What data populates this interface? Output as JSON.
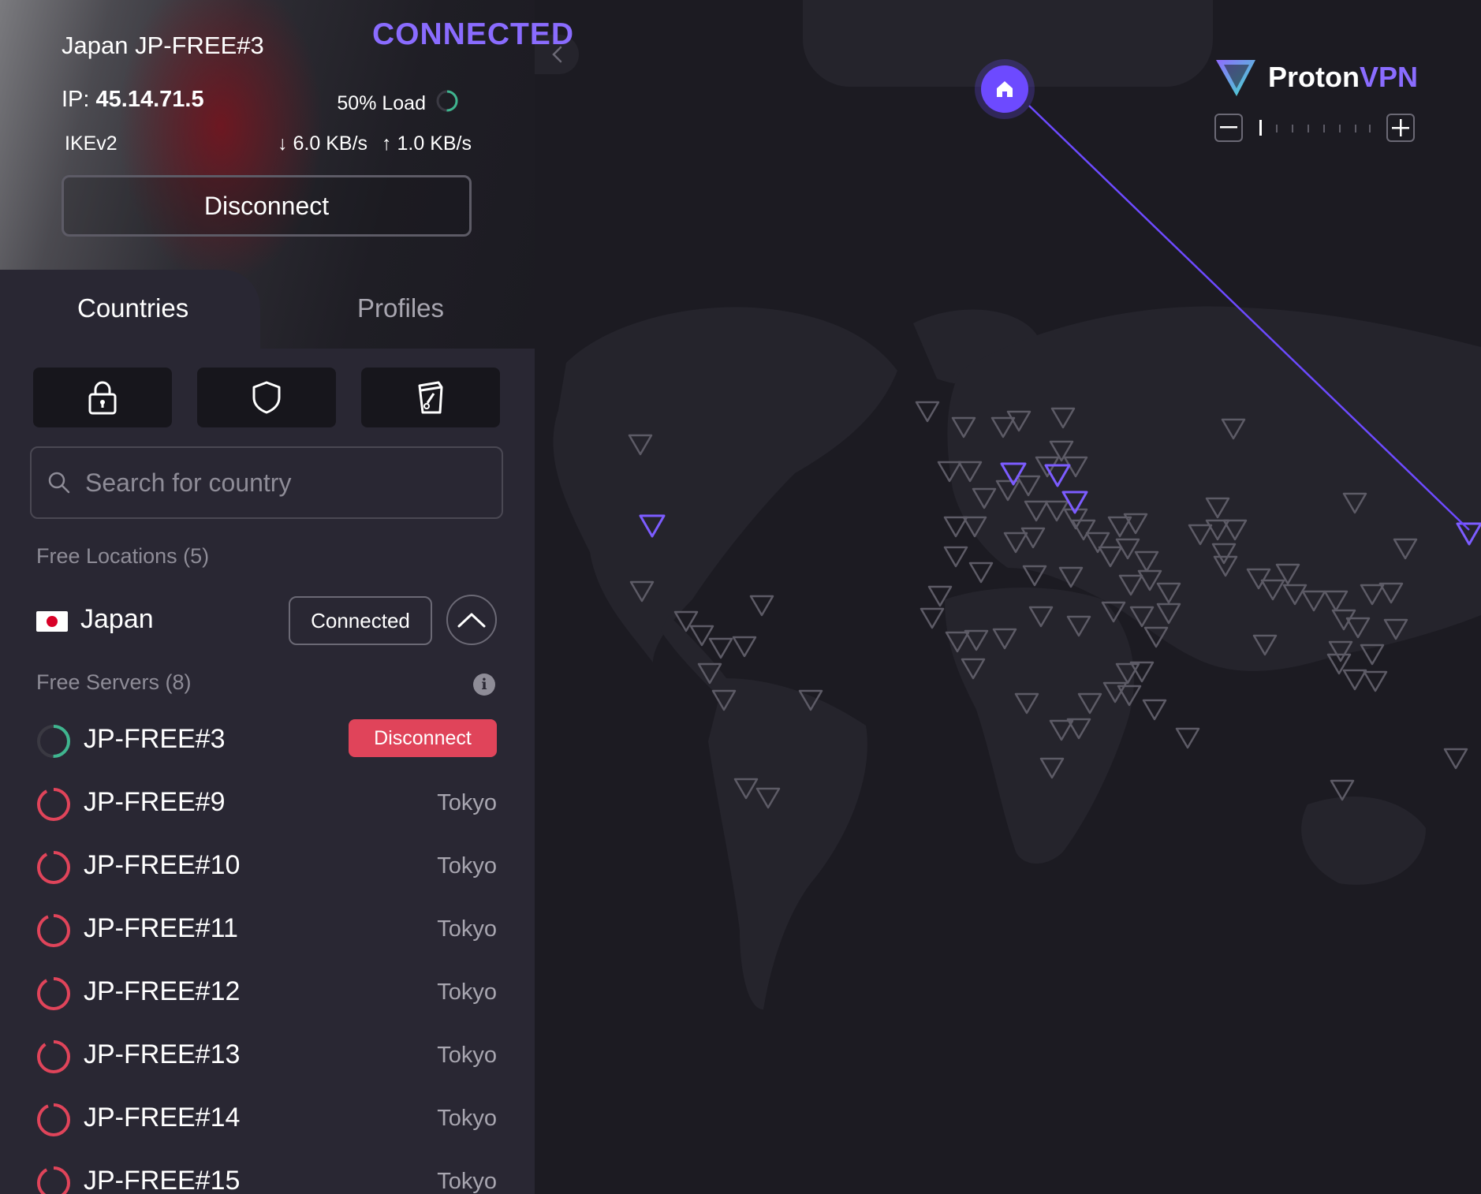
{
  "connection": {
    "title": "Japan JP-FREE#3",
    "ip_label": "IP:",
    "ip": "45.14.71.5",
    "load": "50% Load",
    "load_percent": 50,
    "protocol": "IKEv2",
    "download": "6.0 KB/s",
    "upload": "1.0 KB/s",
    "disconnect_label": "Disconnect",
    "status": "CONNECTED"
  },
  "tabs": [
    {
      "label": "Countries"
    },
    {
      "label": "Profiles"
    }
  ],
  "filters": [
    {
      "icon": "lock-icon"
    },
    {
      "icon": "shield-icon"
    },
    {
      "icon": "streaming-icon"
    }
  ],
  "search": {
    "placeholder": "Search for country"
  },
  "free_locations": {
    "label": "Free Locations (5)",
    "country": "Japan",
    "country_status": "Connected"
  },
  "free_servers": {
    "label": "Free Servers (8)",
    "servers": [
      {
        "name": "JP-FREE#3",
        "action": "Disconnect"
      },
      {
        "name": "JP-FREE#9",
        "city": "Tokyo"
      },
      {
        "name": "JP-FREE#10",
        "city": "Tokyo"
      },
      {
        "name": "JP-FREE#11",
        "city": "Tokyo"
      },
      {
        "name": "JP-FREE#12",
        "city": "Tokyo"
      },
      {
        "name": "JP-FREE#13",
        "city": "Tokyo"
      },
      {
        "name": "JP-FREE#14",
        "city": "Tokyo"
      },
      {
        "name": "JP-FREE#15",
        "city": "Tokyo"
      }
    ]
  },
  "brand": {
    "part1": "Proton",
    "part2": "VPN"
  },
  "colors": {
    "accent": "#6d4aff",
    "danger": "#e0445a",
    "load_good": "#3fb58f",
    "load_high": "#e0445a"
  }
}
